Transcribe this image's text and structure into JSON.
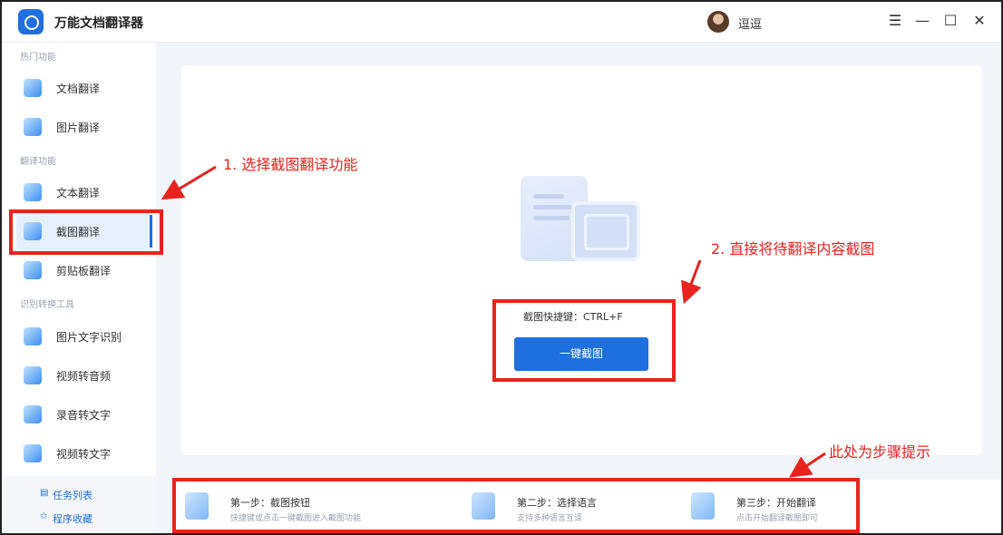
{
  "window": {
    "title": "万能文档翻译器",
    "user": "逗逗",
    "controls": [
      "☰",
      "—",
      "☐",
      "✕"
    ]
  },
  "sidebar": {
    "sections": [
      {
        "label": "热门功能",
        "items": [
          "文档翻译",
          "图片翻译"
        ]
      },
      {
        "label": "翻译功能",
        "items": [
          "文本翻译",
          "截图翻译",
          "剪贴板翻译"
        ]
      },
      {
        "label": "识别转换工具",
        "items": [
          "图片文字识别",
          "视频转音频",
          "录音转文字",
          "视频转文字"
        ]
      }
    ],
    "active_item": "截图翻译",
    "bottom_links": [
      "任务列表",
      "程序收藏"
    ]
  },
  "main": {
    "shortcut_hint": "截图快捷键：CTRL+F",
    "capture_button": "一键截图"
  },
  "steps": [
    {
      "title": "第一步：截图按钮",
      "desc": "快捷键或点击一键截图进入截图功能"
    },
    {
      "title": "第二步：选择语言",
      "desc": "支持多种语言互译"
    },
    {
      "title": "第三步：开始翻译",
      "desc": "点击开始翻译截图即可"
    }
  ],
  "annotations": {
    "a1": "1. 选择截图翻译功能",
    "a2": "2. 直接将待翻译内容截图",
    "a3": "此处为步骤提示"
  },
  "colors": {
    "accent": "#1f6fe0",
    "annotation": "#e8231e"
  }
}
